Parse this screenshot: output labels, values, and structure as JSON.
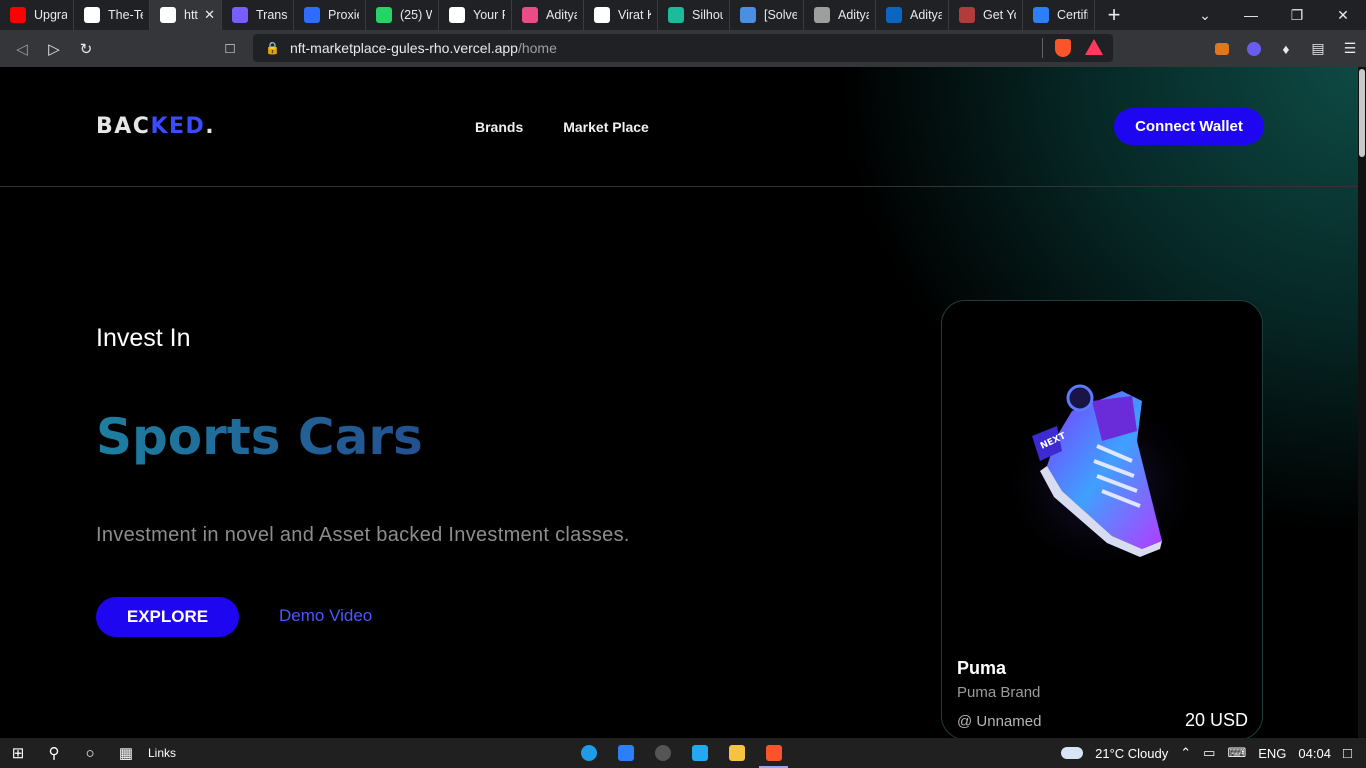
{
  "browser": {
    "tabs": [
      {
        "title": "Upgrad",
        "favicon_color": "#ff0000",
        "icon": "youtube-icon"
      },
      {
        "title": "The-Te",
        "favicon_color": "#ffffff",
        "icon": "github-icon"
      },
      {
        "title": "http",
        "favicon_color": "#ffffff",
        "icon": "vercel-icon",
        "active": true
      },
      {
        "title": "Transp",
        "favicon_color": "#7b5cff",
        "icon": "polygon-icon"
      },
      {
        "title": "Proxies",
        "favicon_color": "#2f6bff",
        "icon": "z-icon"
      },
      {
        "title": "(25) W",
        "favicon_color": "#25d366",
        "icon": "whatsapp-icon"
      },
      {
        "title": "Your R",
        "favicon_color": "#ffffff",
        "icon": "github-icon"
      },
      {
        "title": "Aditya",
        "favicon_color": "#ea4c89",
        "icon": "dribbble-icon"
      },
      {
        "title": "Virat K",
        "favicon_color": "#ffffff",
        "icon": "doc-icon"
      },
      {
        "title": "Silhou",
        "favicon_color": "#1abc9c",
        "icon": "p-icon"
      },
      {
        "title": "[Solvec",
        "favicon_color": "#4a90e2",
        "icon": "info-icon"
      },
      {
        "title": "Aditya",
        "favicon_color": "#9e9e9e",
        "icon": "image-icon"
      },
      {
        "title": "Aditya",
        "favicon_color": "#0a66c2",
        "icon": "linkedin-icon"
      },
      {
        "title": "Get Yo",
        "favicon_color": "#b23b3b",
        "icon": "image-icon"
      },
      {
        "title": "Certific",
        "favicon_color": "#2d7ff9",
        "icon": "cert-icon"
      }
    ],
    "url_host": "nft-marketplace-gules-rho.vercel.app",
    "url_path": "/home"
  },
  "site": {
    "logo_main": "BAC",
    "logo_accent": "KED",
    "logo_dot": ".",
    "nav": {
      "brands": "Brands",
      "marketplace": "Market Place"
    },
    "connect_wallet": "Connect Wallet",
    "hero": {
      "invest_in": "Invest In",
      "headline": "Sports Cars",
      "tagline": "Investment in novel and Asset backed Investment classes.",
      "explore": "EXPLORE",
      "demo": "Demo Video"
    },
    "card": {
      "name": "Puma",
      "brand": "Puma Brand",
      "owner": "@ Unnamed",
      "price": "20 USD"
    },
    "colors": {
      "accent_blue": "#1f06f0",
      "headline_teal": "#1d7fa0"
    }
  },
  "taskbar": {
    "links": "Links",
    "weather": "21°C  Cloudy",
    "lang": "ENG",
    "time": "04:04"
  }
}
